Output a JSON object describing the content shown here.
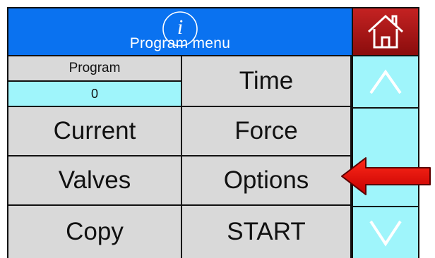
{
  "header": {
    "title": "Program menu",
    "info_icon": "info-icon",
    "home_icon": "home-icon",
    "color": "#0a72f0",
    "home_color": "#a31515"
  },
  "program": {
    "label": "Program",
    "value": "0",
    "value_bg": "#9ff5fb"
  },
  "buttons": {
    "time": "Time",
    "current": "Current",
    "force": "Force",
    "valves": "Valves",
    "options": "Options",
    "copy": "Copy",
    "start": "START"
  },
  "scroll": {
    "up_icon": "chevron-up-icon",
    "down_icon": "chevron-down-icon",
    "bg": "#9ff5fb"
  },
  "annotation": {
    "icon": "red-arrow-icon",
    "color": "#e00000"
  }
}
